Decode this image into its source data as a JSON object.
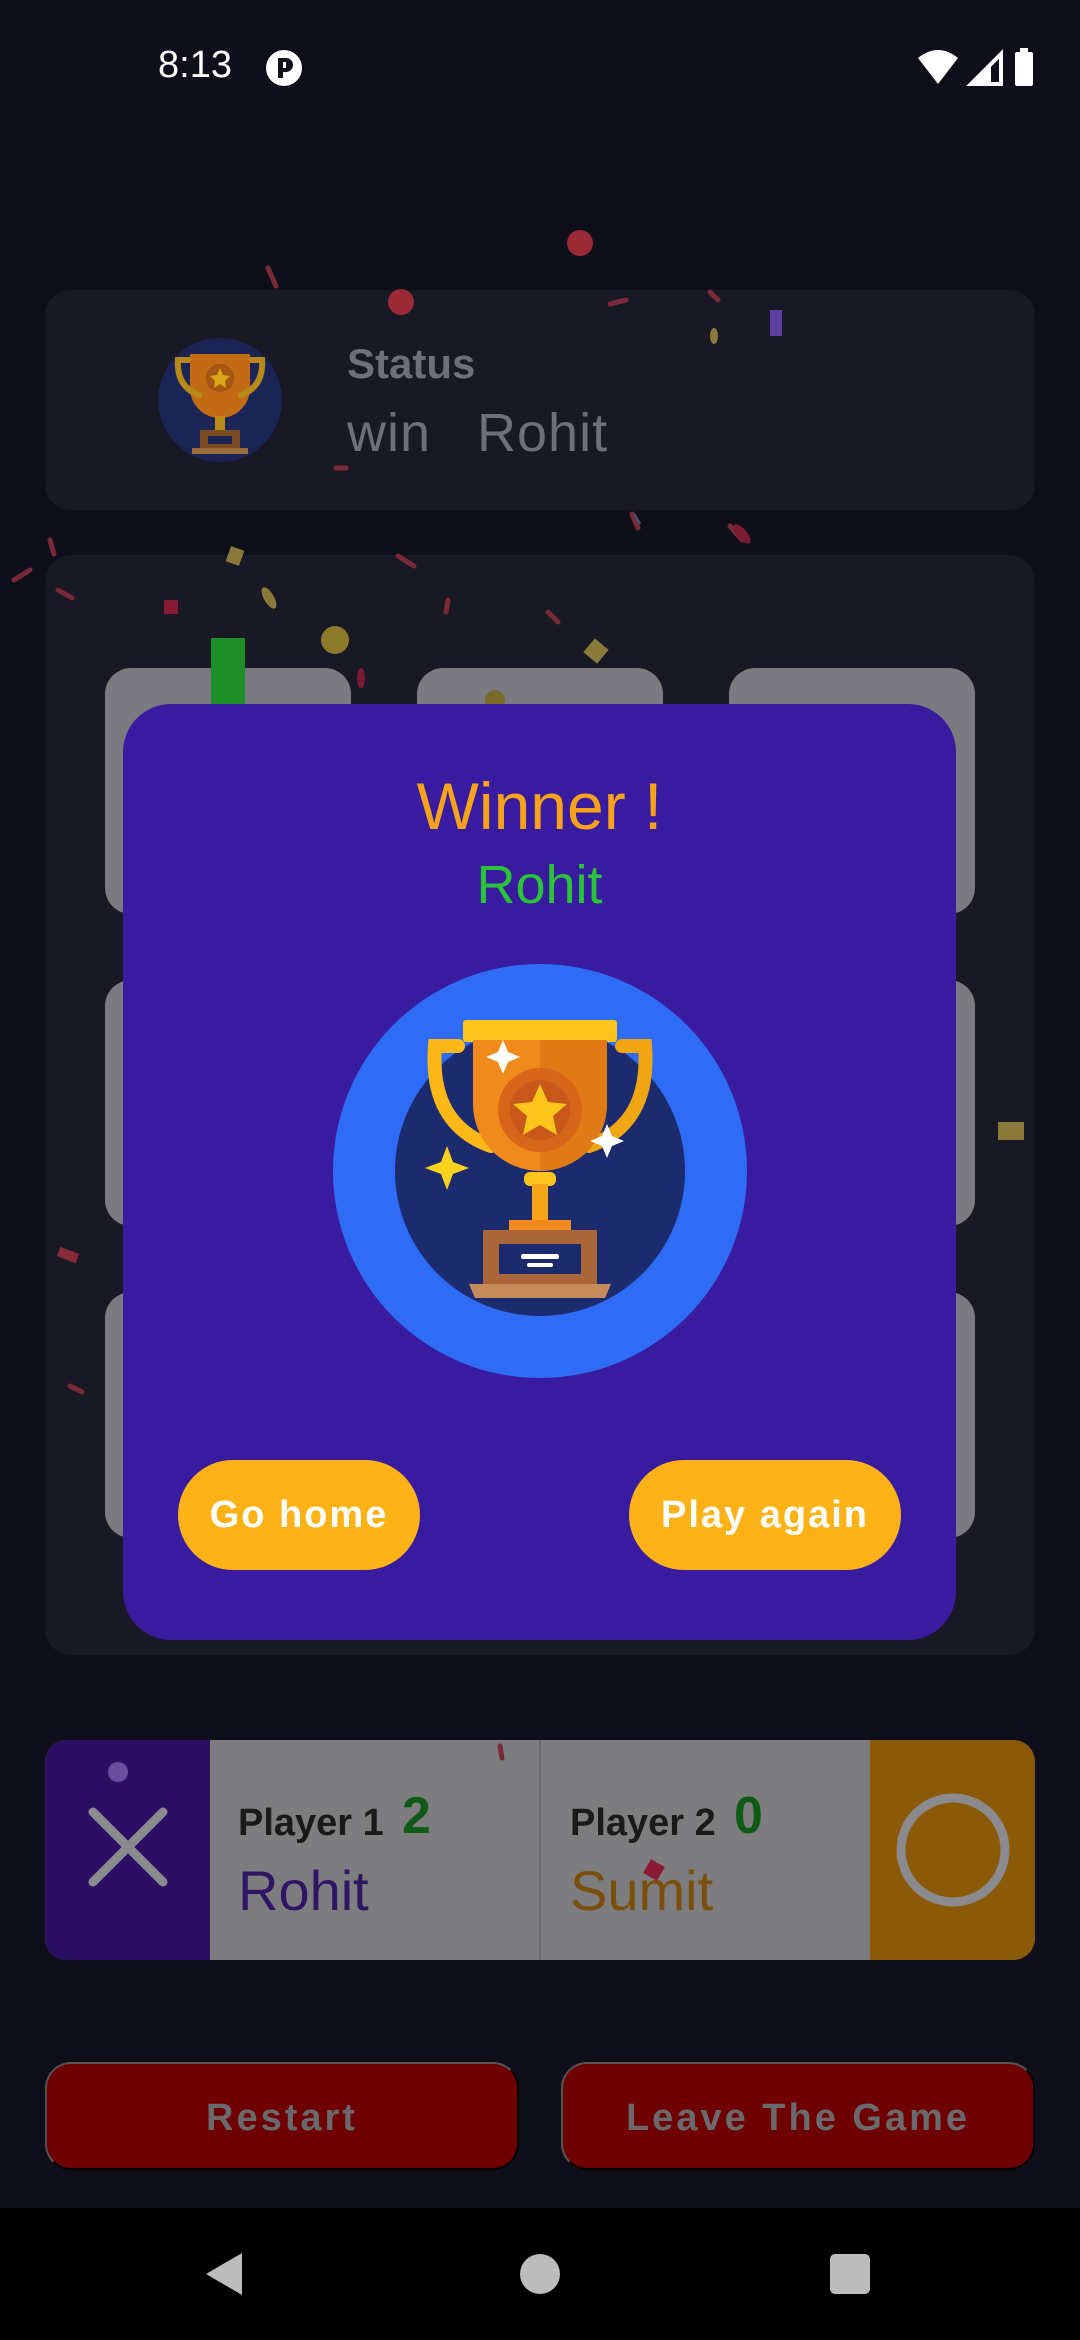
{
  "status_bar": {
    "time": "8:13",
    "icons": [
      "app-notification-icon",
      "wifi-icon",
      "signal-icon",
      "battery-icon"
    ]
  },
  "status_card": {
    "label": "Status",
    "result": "win",
    "player": "Rohit"
  },
  "players": {
    "p1": {
      "title": "Player 1",
      "score": "2",
      "name": "Rohit",
      "symbol": "x-icon"
    },
    "p2": {
      "title": "Player 2",
      "score": "0",
      "name": "Sumit",
      "symbol": "o-icon"
    }
  },
  "actions": {
    "restart": "Restart",
    "leave": "Leave The Game"
  },
  "dialog": {
    "title": "Winner !",
    "winner": "Rohit",
    "go_home": "Go home",
    "play_again": "Play again"
  },
  "colors": {
    "background": "#0e0f1a",
    "dialog": "#391b9f",
    "title": "#f6a31b",
    "winner": "#2bc33a",
    "button": "#fdb217",
    "danger": "#6e0000"
  },
  "navigation": [
    "back-icon",
    "home-icon",
    "recents-icon"
  ]
}
